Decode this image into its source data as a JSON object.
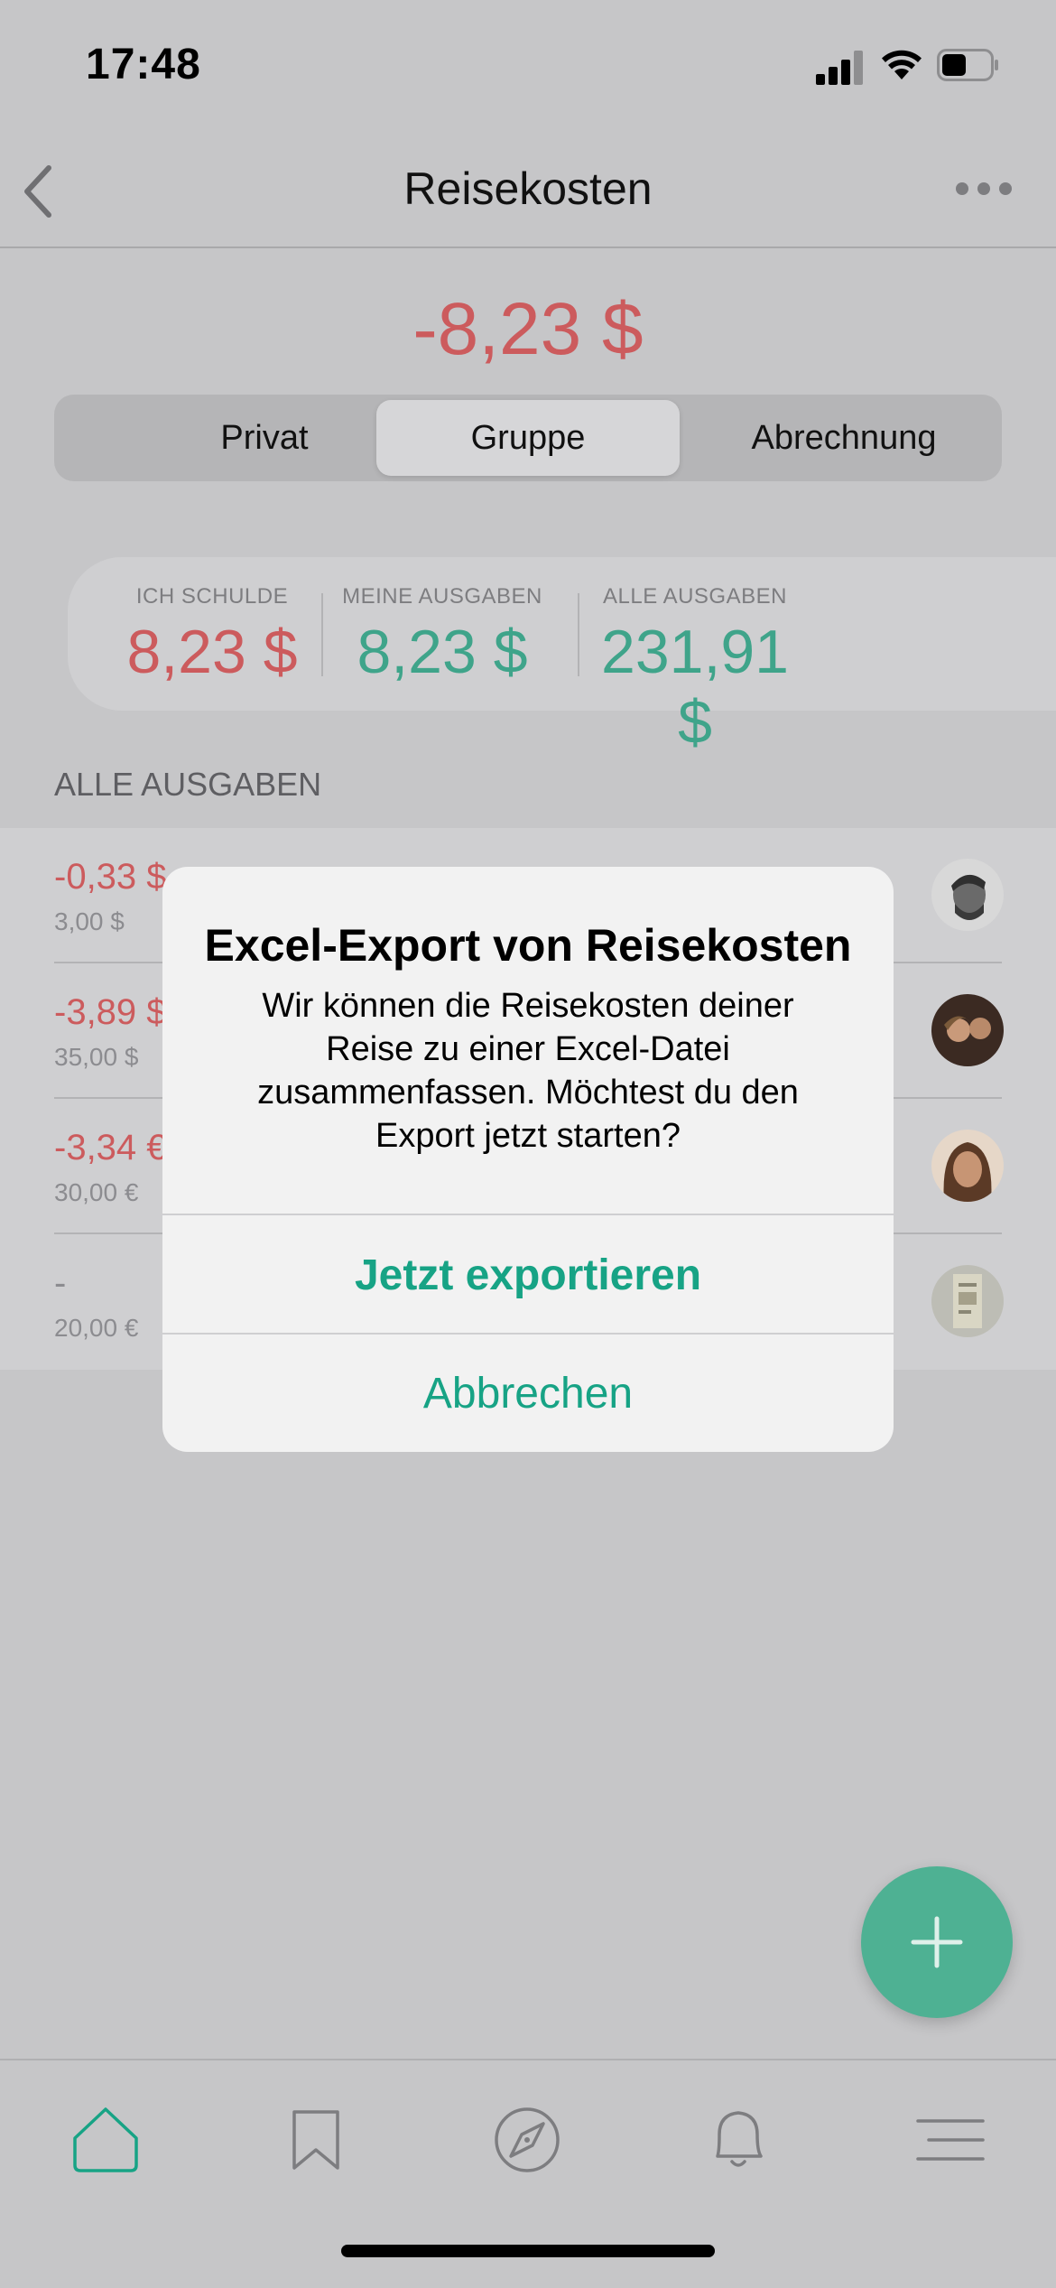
{
  "status": {
    "time": "17:48"
  },
  "nav": {
    "title": "Reisekosten"
  },
  "balance": "-8,23 $",
  "segments": [
    {
      "label": "Privat"
    },
    {
      "label": "Gruppe",
      "selected": true
    },
    {
      "label": "Abrechnung"
    }
  ],
  "summary": [
    {
      "label": "ICH SCHULDE",
      "value": "8,23 $",
      "color": "#cc5b5d"
    },
    {
      "label": "MEINE AUSGABEN",
      "value": "8,23 $",
      "color": "#3fa48a"
    },
    {
      "label": "ALLE AUSGABEN",
      "value": "231,91 $",
      "color": "#3fa48a"
    }
  ],
  "section_header": "ALLE AUSGABEN",
  "expenses": [
    {
      "amount": "-0,33 $",
      "total": "3,00 $",
      "avatar": "avatar-man-icon"
    },
    {
      "amount": "-3,89 $",
      "total": "35,00 $",
      "avatar": "avatar-couple-icon"
    },
    {
      "amount": "-3,34 €",
      "total": "30,00 €",
      "avatar": "avatar-woman-icon"
    },
    {
      "amount": "-",
      "total": "20,00 €",
      "avatar": "receipt-icon"
    }
  ],
  "alert": {
    "title": "Excel-Export von Reisekosten",
    "message": "Wir können die Reisekosten deiner Reise zu einer Excel-Datei zusammenfassen. Möchtest du den Export jetzt starten?",
    "primary_button": "Jetzt exportieren",
    "cancel_button": "Abbrechen"
  },
  "colors": {
    "accent": "#17a385",
    "negative": "#cc5b5d",
    "positive": "#3fa48a",
    "fab": "#4eb193"
  },
  "tabs": [
    "home-icon",
    "bookmark-icon",
    "compass-icon",
    "bell-icon",
    "menu-icon"
  ]
}
